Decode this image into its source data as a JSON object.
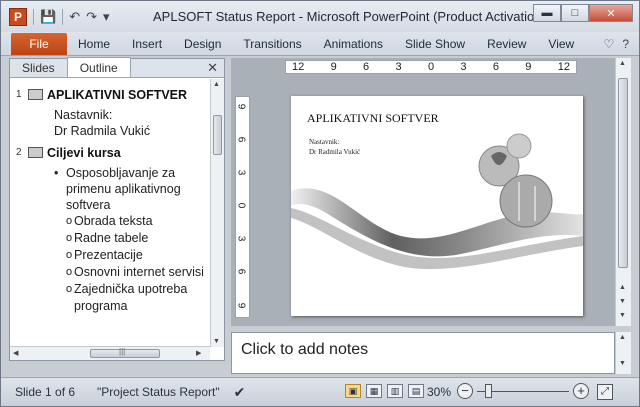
{
  "window": {
    "title": "APLSOFT Status Report  -  Microsoft PowerPoint (Product Activation ...",
    "app_icon_letter": "P",
    "buttons": {
      "minimize": "▬",
      "maximize": "□",
      "close": "✕"
    }
  },
  "qat": {
    "save": "💾",
    "undo": "↶",
    "redo": "↷",
    "customize": "▾"
  },
  "ribbon": {
    "file": "File",
    "tabs": [
      "Home",
      "Insert",
      "Design",
      "Transitions",
      "Animations",
      "Slide Show",
      "Review",
      "View"
    ],
    "help": "?"
  },
  "left_pane": {
    "tabs": [
      "Slides",
      "Outline"
    ],
    "active_tab": "Outline",
    "close": "✕",
    "slides": [
      {
        "number": "1",
        "title": "APLIKATIVNI SOFTVER",
        "subtitle_lines": [
          "Nastavnik:",
          "Dr Radmila Vukić"
        ]
      },
      {
        "number": "2",
        "title": "Ciljevi  kursa",
        "bullet": "Osposobljavanje za primenu aplikativnog softvera",
        "sub_bullets": [
          "Obrada teksta",
          "Radne tabele",
          "Prezentacije",
          "Osnovni  internet servisi",
          "Zajednička upotreba programa"
        ]
      }
    ],
    "hscroll_label": "|||"
  },
  "rulers": {
    "horizontal": [
      "12",
      "9",
      "6",
      "3",
      "0",
      "3",
      "6",
      "9",
      "12"
    ],
    "vertical": [
      "9",
      "6",
      "3",
      "0",
      "3",
      "6",
      "9"
    ]
  },
  "slide": {
    "title": "APLIKATIVNI SOFTVER",
    "sub_lines": [
      "Nastavnik:",
      "Dr Radmila  Vukić"
    ]
  },
  "notes": {
    "placeholder": "Click to add notes"
  },
  "status_bar": {
    "slide_counter": "Slide 1 of 6",
    "theme": "\"Project Status Report\"",
    "zoom": "30%",
    "zoom_level_percent": 30
  }
}
